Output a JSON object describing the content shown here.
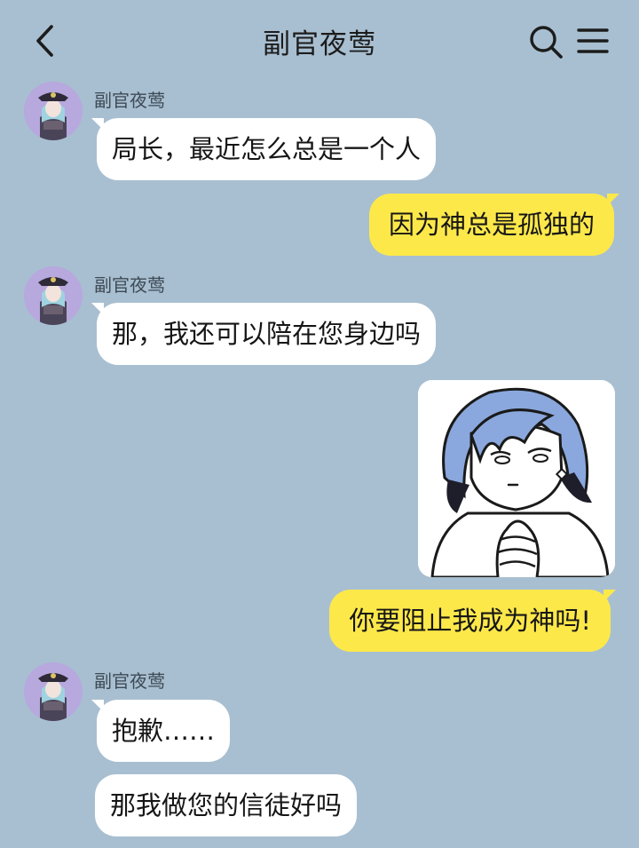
{
  "header": {
    "title": "副官夜莺",
    "back_icon": "chevron-left-icon",
    "search_icon": "search-icon",
    "menu_icon": "hamburger-menu-icon"
  },
  "colors": {
    "background": "#a8bfd1",
    "incoming_bubble": "#ffffff",
    "outgoing_bubble": "#fde84a",
    "avatar_background": "#b7a8de"
  },
  "messages": [
    {
      "direction": "incoming",
      "sender": "副官夜莺",
      "text": "局长，最近怎么总是一个人"
    },
    {
      "direction": "outgoing",
      "text": "因为神总是孤独的"
    },
    {
      "direction": "incoming",
      "sender": "副官夜莺",
      "text": "那，我还可以陪在您身边吗"
    },
    {
      "direction": "outgoing",
      "type": "sticker",
      "sticker": "blue-haired-girl-clasped-hands-sticker"
    },
    {
      "direction": "outgoing",
      "text": "你要阻止我成为神吗!"
    },
    {
      "direction": "incoming",
      "sender": "副官夜莺",
      "text": "抱歉……"
    },
    {
      "direction": "incoming",
      "text": "那我做您的信徒好吗"
    }
  ]
}
